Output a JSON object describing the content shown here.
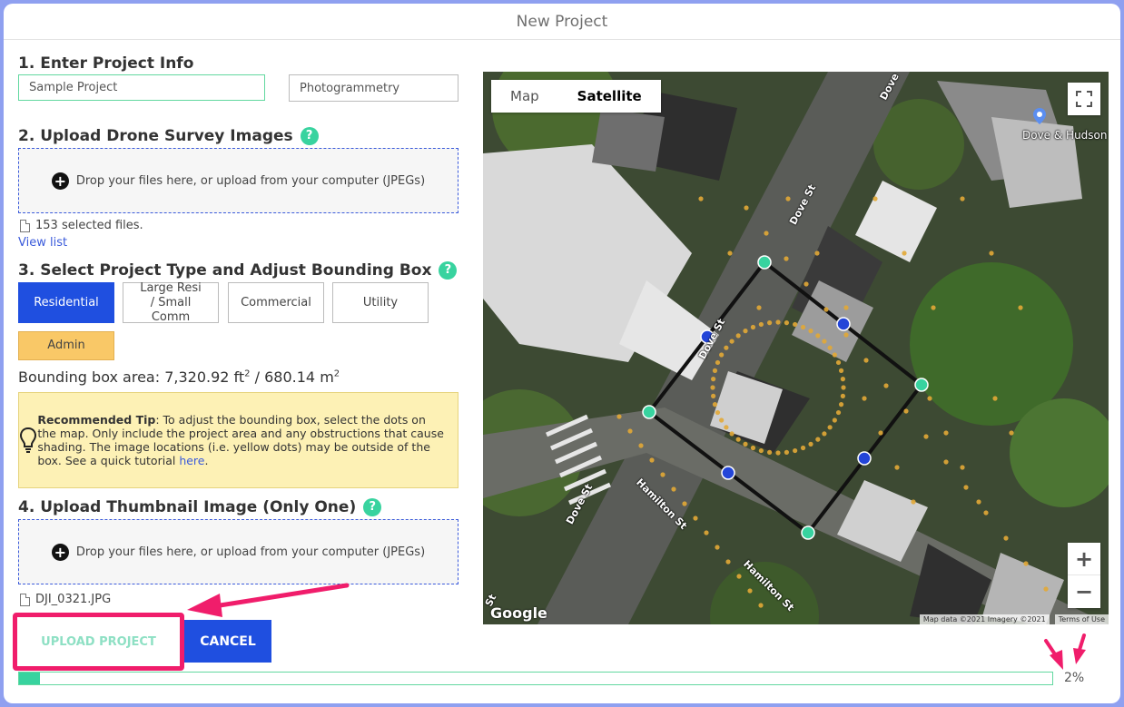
{
  "modal": {
    "title": "New Project"
  },
  "section1": {
    "title": "1. Enter Project Info",
    "name_value": "Sample Project",
    "category_value": "Photogrammetry"
  },
  "section2": {
    "title": "2. Upload Drone Survey Images",
    "help": "?",
    "drop_text": "Drop your files here, or upload from your computer (JPEGs)",
    "selected_files": "153 selected files.",
    "view_list": "View list"
  },
  "section3": {
    "title": "3. Select Project Type and Adjust Bounding Box",
    "help": "?",
    "types": [
      {
        "label": "Residential",
        "state": "active"
      },
      {
        "label": "Large Resi / Small Comm",
        "state": "normal"
      },
      {
        "label": "Commercial",
        "state": "normal"
      },
      {
        "label": "Utility",
        "state": "normal"
      },
      {
        "label": "Admin",
        "state": "admin"
      }
    ],
    "area_label": "Bounding box area:",
    "area_ft": "7,320.92 ft",
    "area_m": "680.14 m",
    "sq": "2",
    "sep": "/",
    "tip_bold": "Recommended Tip",
    "tip_text": ": To adjust the bounding box, select the dots on the map. Only include the project area and any obstructions that cause shading. The image locations (i.e. yellow dots) may be outside of the box. See a quick tutorial ",
    "tip_link": "here",
    "tip_end": "."
  },
  "section4": {
    "title": "4. Upload Thumbnail Image (Only One)",
    "help": "?",
    "drop_text": "Drop your files here, or upload from your computer (JPEGs)",
    "file_name": "DJI_0321.JPG"
  },
  "actions": {
    "upload_label": "UPLOAD PROJECT",
    "cancel_label": "CANCEL"
  },
  "progress": {
    "percent_label": "2%",
    "fraction": 0.02
  },
  "map": {
    "toggle_map": "Map",
    "toggle_satellite": "Satellite",
    "poi_label": "Dove & Hudson",
    "streets": [
      "Dove",
      "Dove St",
      "Dove St",
      "Dove St",
      "Hamilton St",
      "Hamilton St",
      "St"
    ],
    "logo": "Google",
    "attribution": "Map data ©2021 Imagery ©2021",
    "terms": "Terms of Use",
    "zoom_in": "+",
    "zoom_out": "−"
  },
  "colors": {
    "accent_blue": "#1f4fe0",
    "accent_green": "#38d39f",
    "highlight_pink": "#f01d6b",
    "admin_yellow": "#f9c867"
  }
}
